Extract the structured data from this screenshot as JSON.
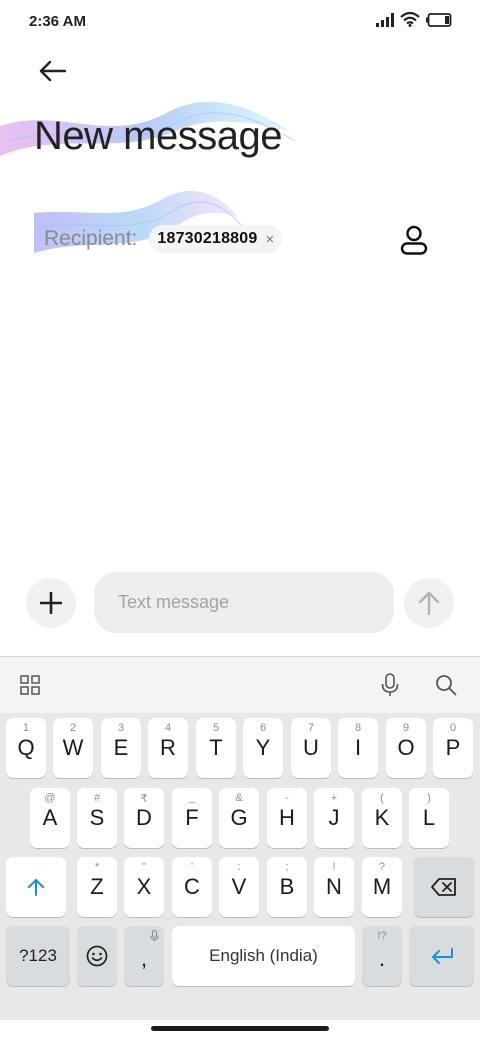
{
  "status_bar": {
    "time": "2:36 AM",
    "icons": [
      "signal-icon",
      "wifi-icon",
      "battery-icon"
    ]
  },
  "header": {
    "back_icon": "arrow-left-icon",
    "title": "New message"
  },
  "recipient": {
    "label": "Recipient:",
    "chips": [
      {
        "text": "18730218809",
        "remove_glyph": "×"
      }
    ],
    "contact_icon": "person-icon"
  },
  "compose": {
    "attach_icon": "plus-icon",
    "placeholder": "Text message",
    "value": "",
    "send_icon": "arrow-up-icon"
  },
  "keyboard": {
    "toolbar": [
      "grid-icon",
      "microphone-icon",
      "search-icon"
    ],
    "rows": [
      [
        {
          "main": "Q",
          "hint": "1"
        },
        {
          "main": "W",
          "hint": "2"
        },
        {
          "main": "E",
          "hint": "3"
        },
        {
          "main": "R",
          "hint": "4"
        },
        {
          "main": "T",
          "hint": "5"
        },
        {
          "main": "Y",
          "hint": "6"
        },
        {
          "main": "U",
          "hint": "7"
        },
        {
          "main": "I",
          "hint": "8"
        },
        {
          "main": "O",
          "hint": "9"
        },
        {
          "main": "P",
          "hint": "0"
        }
      ],
      [
        {
          "main": "A",
          "hint": "@"
        },
        {
          "main": "S",
          "hint": "#"
        },
        {
          "main": "D",
          "hint": "₹"
        },
        {
          "main": "F",
          "hint": "_"
        },
        {
          "main": "G",
          "hint": "&"
        },
        {
          "main": "H",
          "hint": "-"
        },
        {
          "main": "J",
          "hint": "+"
        },
        {
          "main": "K",
          "hint": "("
        },
        {
          "main": "L",
          "hint": ")"
        }
      ],
      [
        {
          "main": "Z",
          "hint": "*"
        },
        {
          "main": "X",
          "hint": "\""
        },
        {
          "main": "C",
          "hint": "'"
        },
        {
          "main": "V",
          "hint": ":"
        },
        {
          "main": "B",
          "hint": ";"
        },
        {
          "main": "N",
          "hint": "!"
        },
        {
          "main": "M",
          "hint": "?"
        }
      ]
    ],
    "shift_icon": "shift-icon",
    "backspace_icon": "backspace-icon",
    "symbols_label": "?123",
    "emoji_icon": "emoji-icon",
    "comma": {
      "main": ",",
      "hint_icon": "microphone-icon"
    },
    "space_label": "English (India)",
    "period": {
      "main": ".",
      "hint": "!?"
    },
    "enter_icon": "enter-icon"
  },
  "colors": {
    "accent": "#1a8fd9",
    "key_bg": "#ffffff",
    "special_key_bg": "#d9dcdf",
    "keyboard_bg": "#e6e8ea"
  }
}
